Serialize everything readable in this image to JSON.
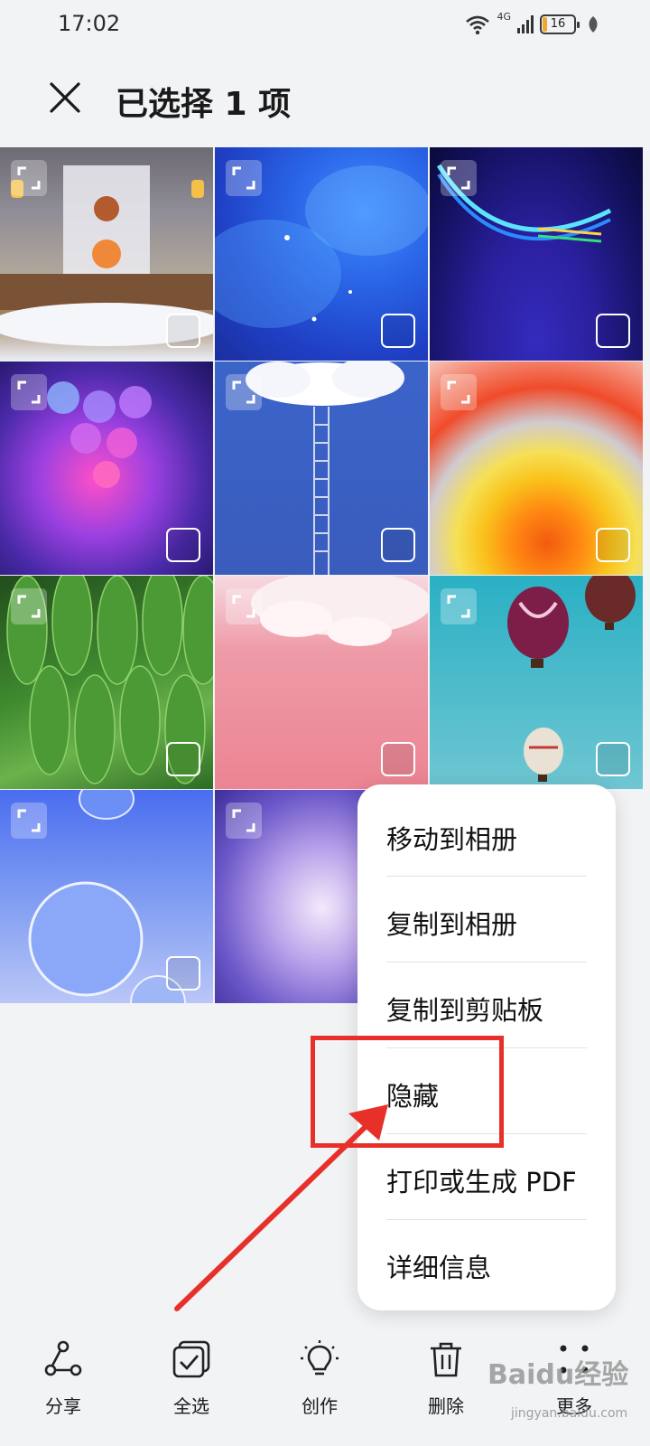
{
  "status_bar": {
    "time": "17:02",
    "network": "4G",
    "battery": "16",
    "battery_level": 0.16
  },
  "header": {
    "title": "已选择 1 项",
    "close_icon": "close-icon"
  },
  "grid": {
    "selected_count": 1,
    "tiles": [
      {
        "name": "game-scene"
      },
      {
        "name": "blue-bubbles"
      },
      {
        "name": "neon-curve"
      },
      {
        "name": "purple-spheres"
      },
      {
        "name": "cloud-ladder"
      },
      {
        "name": "colorful-layers"
      },
      {
        "name": "green-leaves"
      },
      {
        "name": "pink-cloud"
      },
      {
        "name": "hot-air-balloons"
      },
      {
        "name": "water-droplets"
      },
      {
        "name": "purple-swirl"
      }
    ]
  },
  "menu": {
    "items": [
      {
        "label": "移动到相册"
      },
      {
        "label": "复制到相册"
      },
      {
        "label": "复制到剪贴板"
      },
      {
        "label": "隐藏"
      },
      {
        "label": "打印或生成 PDF"
      },
      {
        "label": "详细信息"
      }
    ]
  },
  "toolbar": {
    "share": "分享",
    "select_all": "全选",
    "create": "创作",
    "delete": "删除",
    "more": "更多"
  },
  "watermark": {
    "logo": "Baidu经验",
    "url": "jingyan.baidu.com"
  },
  "colors": {
    "accent_red": "#e8302b",
    "menu_bg": "#ffffff",
    "page_bg": "#f1f3f5"
  }
}
